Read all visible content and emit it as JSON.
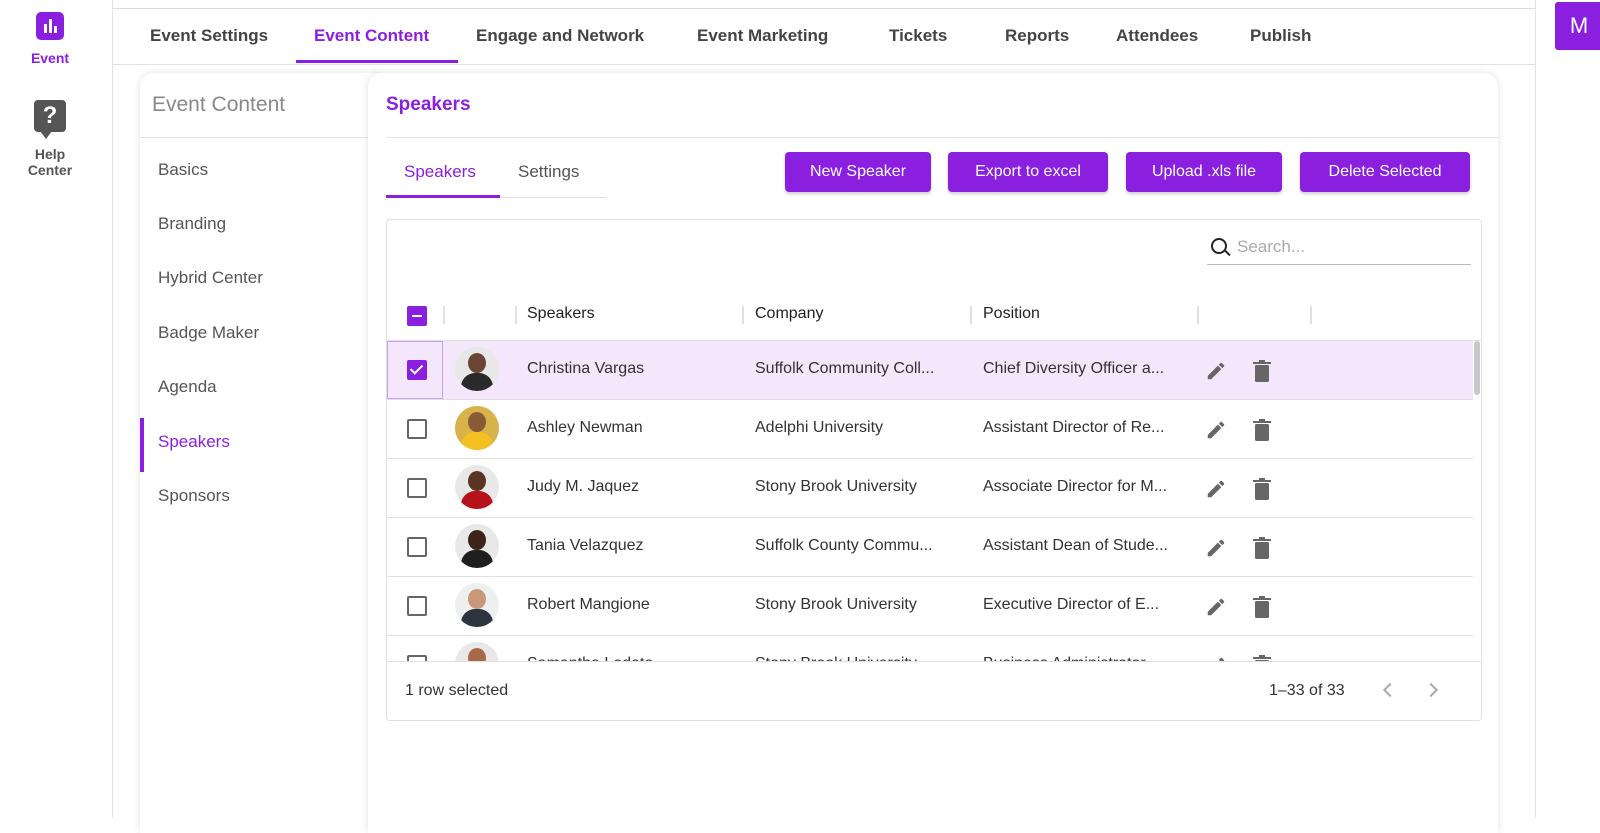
{
  "rail": {
    "event_label": "Event",
    "help_label_1": "Help",
    "help_label_2": "Center",
    "help_glyph": "?"
  },
  "topnav": {
    "tabs": [
      {
        "label": "Event Settings"
      },
      {
        "label": "Event Content"
      },
      {
        "label": "Engage and Network"
      },
      {
        "label": "Event Marketing"
      },
      {
        "label": "Tickets"
      },
      {
        "label": "Reports"
      },
      {
        "label": "Attendees"
      },
      {
        "label": "Publish"
      }
    ],
    "active_tab": "Event Content"
  },
  "user_avatar": "M",
  "sidebar": {
    "title": "Event Content",
    "items": [
      {
        "label": "Basics"
      },
      {
        "label": "Branding"
      },
      {
        "label": "Hybrid Center"
      },
      {
        "label": "Badge Maker"
      },
      {
        "label": "Agenda"
      },
      {
        "label": "Speakers"
      },
      {
        "label": "Sponsors"
      }
    ],
    "active_item": "Speakers"
  },
  "main": {
    "title": "Speakers",
    "subtabs": [
      {
        "label": "Speakers"
      },
      {
        "label": "Settings"
      }
    ],
    "buttons": {
      "new_speaker": "New Speaker",
      "export": "Export to excel",
      "upload": "Upload .xls file",
      "delete_selected": "Delete Selected"
    },
    "search": {
      "placeholder": "Search..."
    },
    "table": {
      "columns": [
        "Speakers",
        "Company",
        "Position"
      ],
      "rows": [
        {
          "name": "Christina Vargas",
          "company": "Suffolk Community Coll...",
          "position": "Chief Diversity Officer a...",
          "selected": true
        },
        {
          "name": "Ashley Newman",
          "company": "Adelphi University",
          "position": "Assistant Director of Re...",
          "selected": false
        },
        {
          "name": "Judy M. Jaquez",
          "company": "Stony Brook University",
          "position": "Associate Director for M...",
          "selected": false
        },
        {
          "name": "Tania Velazquez",
          "company": "Suffolk County Commu...",
          "position": "Assistant Dean of Stude...",
          "selected": false
        },
        {
          "name": "Robert Mangione",
          "company": "Stony Brook University",
          "position": "Executive Director of E...",
          "selected": false
        },
        {
          "name": "Samantha Lodato",
          "company": "Stony Brook University",
          "position": "Business Administrator",
          "selected": false
        }
      ]
    },
    "footer": {
      "selected_text": "1 row selected",
      "pagination": "1–33 of 33"
    }
  },
  "colors": {
    "accent": "#8a1fe0",
    "selected_row": "#f4e6fb"
  }
}
